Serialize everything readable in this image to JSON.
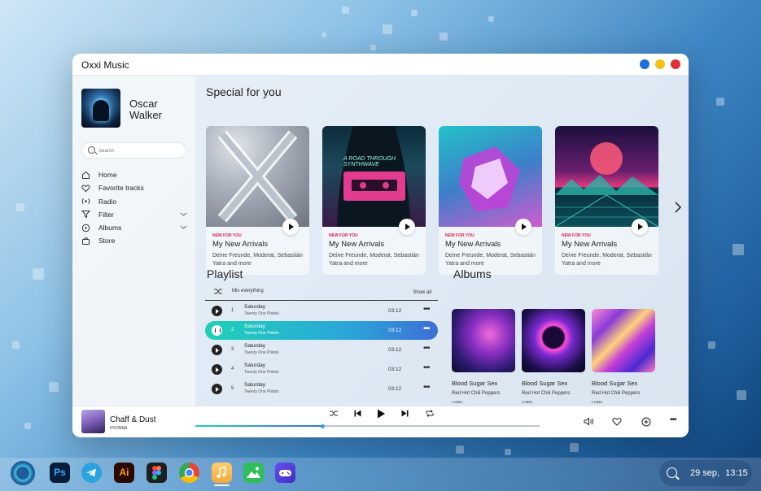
{
  "window": {
    "title": "Oxxi Music",
    "dots": [
      "#1f6fe0",
      "#f2c21b",
      "#e0313a"
    ]
  },
  "sidebar": {
    "user_name": "Oscar Walker",
    "search_placeholder": "Search",
    "items": [
      {
        "label": "Home",
        "icon": "home-icon"
      },
      {
        "label": "Favorite tracks",
        "icon": "heart-icon"
      },
      {
        "label": "Radio",
        "icon": "radio-icon"
      },
      {
        "label": "Filter",
        "icon": "filter-icon",
        "expandable": true
      },
      {
        "label": "Albums",
        "icon": "album-icon",
        "expandable": true
      },
      {
        "label": "Store",
        "icon": "store-icon"
      }
    ]
  },
  "special": {
    "title": "Special for you",
    "cards": [
      {
        "tag": "NEW FOR YOU",
        "title": "My New Arrivals",
        "desc": "Deine Freunde, Moderat, Sebastián Yatra and more"
      },
      {
        "tag": "NEW FOR YOU",
        "title": "My New Arrivals",
        "desc": "Deine Freunde, Moderat, Sebastián Yatra and more",
        "art_text": "A ROAD THROUGH SYNTHWAVE"
      },
      {
        "tag": "NEW FOR YOU",
        "title": "My New Arrivals",
        "desc": "Deine Freunde, Moderat, Sebastián Yatra and more"
      },
      {
        "tag": "NEW FOR YOU",
        "title": "My New Arrivals",
        "desc": "Deine Freunde, Moderat, Sebastián Yatra and more"
      }
    ]
  },
  "playlist": {
    "title": "Playlist",
    "mix_label": "Mix everything",
    "show_all": "Show all",
    "tracks": [
      {
        "num": "1",
        "name": "Saturday",
        "artist": "Twenty One Pistols",
        "duration": "03:12",
        "active": false
      },
      {
        "num": "2",
        "name": "Saturday",
        "artist": "Twenty One Pistols",
        "duration": "03:12",
        "active": true
      },
      {
        "num": "3",
        "name": "Saturday",
        "artist": "Twenty One Pistols",
        "duration": "03:12",
        "active": false
      },
      {
        "num": "4",
        "name": "Saturday",
        "artist": "Twenty One Pistols",
        "duration": "03:12",
        "active": false
      },
      {
        "num": "5",
        "name": "Saturday",
        "artist": "Twenty One Pistols",
        "duration": "03:12",
        "active": false
      }
    ]
  },
  "albums": {
    "title": "Albums",
    "items": [
      {
        "title": "Blood Sugar Sex",
        "artist": "Red Hot Chili Peppers",
        "label": "LABEL"
      },
      {
        "title": "Blood Sugar Sex",
        "artist": "Red Hot Chili Peppers",
        "label": "LABEL"
      },
      {
        "title": "Blood Sugar Sex",
        "artist": "Red Hot Chili Peppers",
        "label": "LABEL"
      }
    ]
  },
  "player": {
    "title": "Chaff & Dust",
    "artist": "HYONNA",
    "progress": 0.37
  },
  "taskbar": {
    "apps": [
      "Ps",
      "Telegram",
      "Ai",
      "Figma",
      "Chrome",
      "Music",
      "Gallery",
      "Games"
    ],
    "date": "29 sep,",
    "time": "13:15"
  }
}
